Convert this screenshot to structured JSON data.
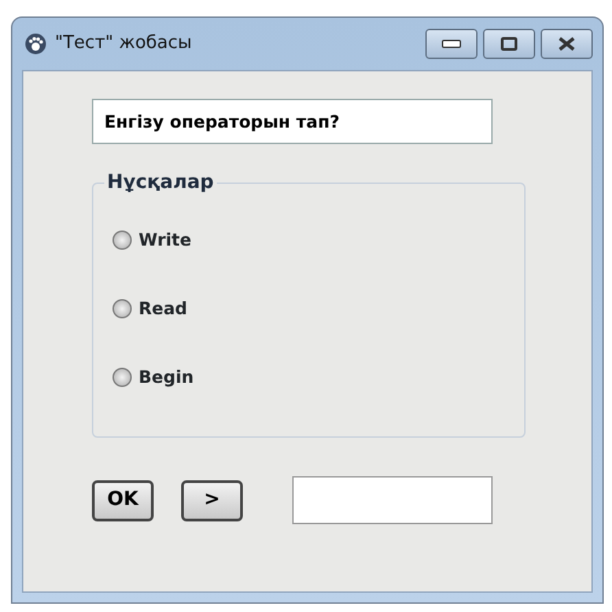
{
  "window": {
    "title": "\"Тест\" жобасы"
  },
  "question": {
    "value": "Енгізу операторын тап?"
  },
  "options_group": {
    "title": "Нұсқалар",
    "options": [
      {
        "label": "Write",
        "selected": false
      },
      {
        "label": "Read",
        "selected": false
      },
      {
        "label": "Begin",
        "selected": false
      }
    ]
  },
  "buttons": [
    {
      "label": "OK"
    },
    {
      "label": ">"
    }
  ]
}
